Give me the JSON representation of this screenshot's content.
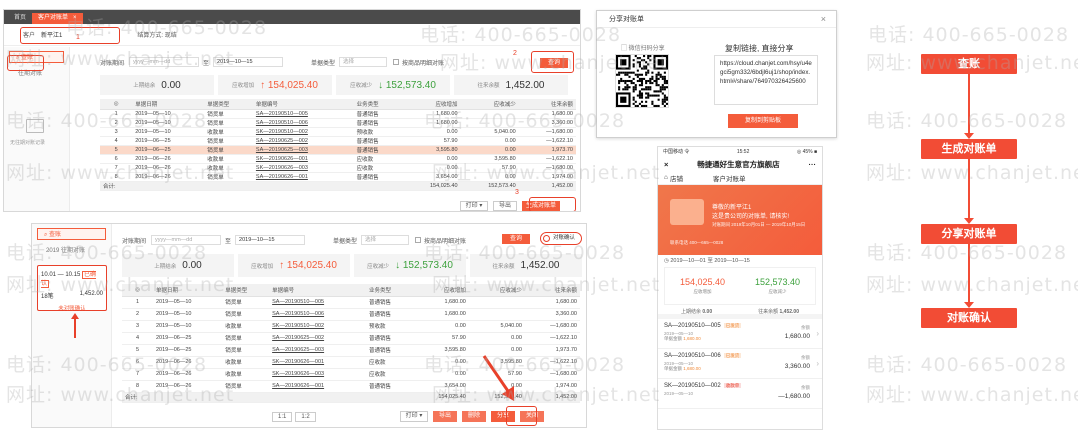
{
  "watermark": {
    "phone": "电话: 400-665-0028",
    "site": "网址: www.chanjet.net"
  },
  "colors": {
    "accent": "#f45c3b",
    "flow": "#f24c35",
    "increase": "#f45c3b",
    "decrease": "#3da13d"
  },
  "top_screen": {
    "tabs": [
      {
        "label": "首页"
      },
      {
        "label": "客户对账单",
        "close": "×"
      }
    ],
    "customer_label": "客户",
    "customer_value": "新平江1",
    "settlement_label": "结算方式: 现结",
    "sidebar": {
      "active": "查账",
      "sub": "往期对账",
      "empty_text": "无往期对账记录"
    },
    "filter": {
      "period_label": "对账期间",
      "start_placeholder": "yyyy—mm—dd",
      "to_label": "至",
      "end_value": "2019—10—15",
      "bill_type_label": "单据类型",
      "bill_type_placeholder": "选择",
      "by_goods_label": "按商品明细对账",
      "query_button": "查询"
    },
    "summary": {
      "opening_label": "上期结余",
      "opening": "0.00",
      "increase_label": "应收增加",
      "increase": "154,025.40",
      "decrease_label": "应收减少",
      "decrease": "152,573.40",
      "balance_label": "往来余额",
      "balance": "1,452.00"
    },
    "table": {
      "columns": [
        "单据日期",
        "单据类型",
        "单据编号",
        "业务类型",
        "应收增加",
        "应收减少",
        "往来余额"
      ],
      "rows": [
        [
          "1",
          "2019—05—10",
          "销货单",
          "SA—20190510—005",
          "普通销售",
          "1,680.00",
          "",
          "1,680.00"
        ],
        [
          "2",
          "2019—05—10",
          "销货单",
          "SA—20190510—006",
          "普通销售",
          "1,680.00",
          "",
          "3,360.00"
        ],
        [
          "3",
          "2019—05—10",
          "收款单",
          "SK—20190510—002",
          "预收款",
          "0.00",
          "5,040.00",
          "—1,680.00"
        ],
        [
          "4",
          "2019—06—25",
          "销货单",
          "SA—20190625—002",
          "普通销售",
          "57.90",
          "0.00",
          "—1,622.10"
        ],
        [
          "5",
          "2019—06—25",
          "销货单",
          "SA—20190625—003",
          "普通销售",
          "3,595.80",
          "0.00",
          "1,973.70"
        ],
        [
          "6",
          "2019—06—26",
          "收款单",
          "SK—20190626—001",
          "应收款",
          "0.00",
          "3,595.80",
          "—1,622.10"
        ],
        [
          "7",
          "2019—06—26",
          "收款单",
          "SK—20190626—003",
          "应收款",
          "0.00",
          "57.90",
          "—1,680.00"
        ],
        [
          "8",
          "2019—06—26",
          "销货单",
          "SA—20190626—001",
          "普通销售",
          "3,654.00",
          "0.00",
          "1,974.00"
        ]
      ],
      "total_label": "合计:",
      "total_increase": "154,025.40",
      "total_decrease": "152,573.40",
      "total_balance": "1,452.00"
    },
    "buttons": {
      "print": "打印",
      "export": "导出",
      "generate": "生成对账单"
    },
    "marks": [
      "1",
      "2",
      "3"
    ]
  },
  "bottom_screen": {
    "sidebar": {
      "active": "查账",
      "sub": "2019 往期对账",
      "period": "10.01 — 10.15",
      "status": "已确认",
      "balance_label": "18笔",
      "balance": "1,452.00",
      "unconfirmed": "未对账确认"
    },
    "filter": {
      "period_label": "对账期间",
      "start_placeholder": "yyyy—mm—dd",
      "to_label": "至",
      "end_value": "2019—10—15",
      "bill_type_label": "单据类型",
      "bill_type_placeholder": "选择",
      "by_goods_label": "按商品明细对账",
      "query_button": "查询",
      "confirm_toggle": "对账确认"
    },
    "summary": {
      "opening_label": "上期结余",
      "opening": "0.00",
      "increase_label": "应收增加",
      "increase": "154,025.40",
      "decrease_label": "应收减少",
      "decrease": "152,573.40",
      "balance_label": "往来余额",
      "balance": "1,452.00"
    },
    "table": {
      "columns": [
        "单据日期",
        "单据类型",
        "单据编号",
        "业务类型",
        "应收增加",
        "应收减少",
        "往来余额"
      ],
      "rows": [
        [
          "1",
          "2019—05—10",
          "销货单",
          "SA—20190510—005",
          "普通销售",
          "1,680.00",
          "",
          "1,680.00"
        ],
        [
          "2",
          "2019—05—10",
          "销货单",
          "SA—20190510—006",
          "普通销售",
          "1,680.00",
          "",
          "3,360.00"
        ],
        [
          "3",
          "2019—05—10",
          "收款单",
          "SK—20190510—002",
          "预收款",
          "0.00",
          "5,040.00",
          "—1,680.00"
        ],
        [
          "4",
          "2019—06—25",
          "销货单",
          "SA—20190625—002",
          "普通销售",
          "57.90",
          "0.00",
          "—1,622.10"
        ],
        [
          "5",
          "2019—06—25",
          "销货单",
          "SA—20190625—003",
          "普通销售",
          "3,595.80",
          "0.00",
          "1,973.70"
        ],
        [
          "6",
          "2019—06—26",
          "收款单",
          "SK—20190626—001",
          "应收款",
          "0.00",
          "3,595.80",
          "—1,622.10"
        ],
        [
          "7",
          "2019—06—26",
          "收款单",
          "SK—20190626—003",
          "应收款",
          "0.00",
          "57.90",
          "—1,680.00"
        ],
        [
          "8",
          "2019—06—26",
          "销货单",
          "SA—20190626—001",
          "普通销售",
          "3,654.00",
          "0.00",
          "1,974.00"
        ]
      ],
      "total_label": "合计:",
      "total_increase": "154,025.40",
      "total_decrease": "152,573.40",
      "total_balance": "1,452.00"
    },
    "pager": {
      "first": "1:1",
      "second": "1:2"
    },
    "buttons": {
      "print": "打印",
      "export": "导出",
      "delete": "删除",
      "share": "分享",
      "close": "关闭"
    }
  },
  "share_dialog": {
    "title": "分享对账单",
    "close": "×",
    "qr_label": "微信扫码分享",
    "copy_title": "复制链接, 直接分享",
    "url": "https://cloud.chanjet.com/hsy/u4egci5gm332/6bdjl6uj1/shop/index.html#/share/764970326425600",
    "copy_button": "复制到剪贴板"
  },
  "phone": {
    "status_left": "中国移动 令",
    "status_time": "15:52",
    "status_right": "◎ 45% ■",
    "shop_title": "畅捷通好生意官方旗舰店",
    "more": "···",
    "back": "×",
    "home_label": "店铺",
    "page_title": "客户对账单",
    "banner_line1": "尊敬的新平江1",
    "banner_line2": "这是贵公司的对账单, 请核实!",
    "banner_line3": "对账期间 2019年10月01日 — 2019年10月15日",
    "banner_line4": "联系电话 400—665—0028",
    "range": "2019—10—01 至 2019—10—15",
    "increase": "154,025.40",
    "increase_label": "应收增加",
    "decrease": "152,573.40",
    "decrease_label": "应收减少",
    "opening_label": "上期结余",
    "opening": "0.00",
    "balance_label": "往来余额",
    "balance": "1,452.00",
    "bills": [
      {
        "no": "SA—20190510—005",
        "tag": "已发货",
        "date": "2019—05—10",
        "amount_label": "单据金额",
        "amount": "1,680.00",
        "right_label": "余额",
        "right_value": "1,680.00"
      },
      {
        "no": "SA—20190510—006",
        "tag": "已发货",
        "date": "2019—05—10",
        "amount_label": "单据金额",
        "amount": "1,680.00",
        "right_label": "余额",
        "right_value": "3,360.00"
      },
      {
        "no": "SK—20190510—002",
        "tag": "收款单",
        "date": "2019—05—10",
        "amount_label": "",
        "amount": "",
        "right_label": "余额",
        "right_value": "—1,680.00"
      }
    ]
  },
  "flow": {
    "steps": [
      "查账",
      "生成对账单",
      "分享对账单",
      "对账确认"
    ]
  }
}
